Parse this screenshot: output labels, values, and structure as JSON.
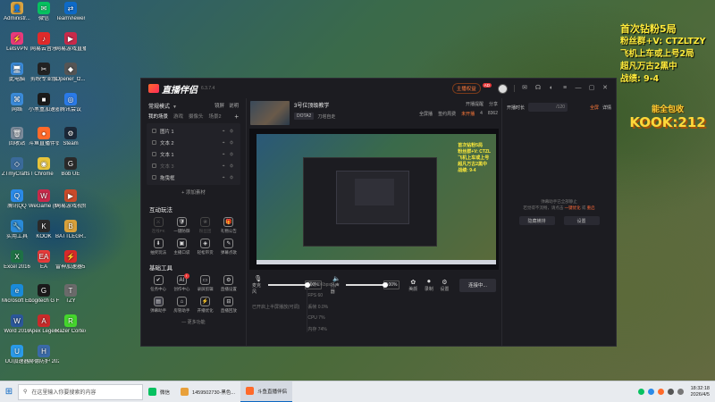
{
  "desktop_icons": [
    {
      "label": "Administr...",
      "color": "#d9a441",
      "glyph": "👤"
    },
    {
      "label": "微信",
      "color": "#07c160",
      "glyph": "✉"
    },
    {
      "label": "TeamViewer",
      "color": "#0e6ac7",
      "glyph": "⇄"
    },
    {
      "label": "LetsVPN",
      "color": "#e83a7a",
      "glyph": "⚡"
    },
    {
      "label": "网易云音乐",
      "color": "#e02a2a",
      "glyph": "♪"
    },
    {
      "label": "网易游戏直播间",
      "color": "#c82a4a",
      "glyph": "▶"
    },
    {
      "label": "此电脑",
      "color": "#3a8ad8",
      "glyph": "🖥"
    },
    {
      "label": "剪映专业版",
      "color": "#222222",
      "glyph": "✂"
    },
    {
      "label": "Opener_tz...",
      "color": "#555555",
      "glyph": "◆"
    },
    {
      "label": "网络",
      "color": "#3a8ad8",
      "glyph": "⌘"
    },
    {
      "label": "小黑盒加速器",
      "color": "#1a1a1a",
      "glyph": "■"
    },
    {
      "label": "腾讯会议",
      "color": "#2a7ae8",
      "glyph": "◎"
    },
    {
      "label": "回收站",
      "color": "#7a8a9a",
      "glyph": "🗑"
    },
    {
      "label": "斗鱼直播伴侣",
      "color": "#ff6a2a",
      "glyph": "●"
    },
    {
      "label": "Steam",
      "color": "#1b2838",
      "glyph": "⚙"
    },
    {
      "label": "ZTmyCrafts Launcher",
      "color": "#3a6a9a",
      "glyph": "◇"
    },
    {
      "label": "Chrome",
      "color": "#e8c43a",
      "glyph": "◉"
    },
    {
      "label": "Bob UE",
      "color": "#2a2a2a",
      "glyph": "G"
    },
    {
      "label": "腾讯QQ",
      "color": "#2a8ae8",
      "glyph": "Q"
    },
    {
      "label": "WeGame (Marginal)",
      "color": "#c82a4a",
      "glyph": "W"
    },
    {
      "label": "网易游戏视频直播",
      "color": "#c84a2a",
      "glyph": "▶"
    },
    {
      "label": "实用工具",
      "color": "#2a8ad8",
      "glyph": "🔧"
    },
    {
      "label": "KOOK",
      "color": "#2a2a2a",
      "glyph": "K"
    },
    {
      "label": "BATTLEGR...",
      "color": "#d8a03a",
      "glyph": "B"
    },
    {
      "label": "Excel 2016",
      "color": "#1e7145",
      "glyph": "X"
    },
    {
      "label": "EA",
      "color": "#e83a3a",
      "glyph": "EA"
    },
    {
      "label": "雷神加速器5.0",
      "color": "#d82a2a",
      "glyph": "⚡"
    },
    {
      "label": "Microsoft Edge",
      "color": "#1a8ad8",
      "glyph": "e"
    },
    {
      "label": "Logitech G HUB",
      "color": "#1a1a1a",
      "glyph": "G"
    },
    {
      "label": "TZY",
      "color": "#6a6a6a",
      "glyph": "T"
    },
    {
      "label": "Word 2016",
      "color": "#2b579a",
      "glyph": "W"
    },
    {
      "label": "Apex Legends",
      "color": "#c82a2a",
      "glyph": "A"
    },
    {
      "label": "Razer Cortex",
      "color": "#44d62c",
      "glyph": "R"
    },
    {
      "label": "UU加速器",
      "color": "#2a9ae8",
      "glyph": "U"
    },
    {
      "label": "赫德防护 20260...",
      "color": "#3a6aa8",
      "glyph": "H"
    }
  ],
  "overlay": {
    "line1": "首次钻粉5局",
    "line2": "粉丝群+V: CTZLTZY",
    "line3": "飞机上车或上号2局",
    "line4": "超凡万古2黑中",
    "line5": "战绩: 9-4"
  },
  "kook": {
    "top": "能全包收",
    "main": "KOOK:212"
  },
  "app": {
    "name": "直播伴侣",
    "version": "6.3.7.4",
    "host_label": "主播权益",
    "ad_label": "AD",
    "mode": "常规模式",
    "mode_links": [
      "镜屏",
      "说明"
    ],
    "scene_label": "我的场景",
    "scene_tabs": [
      "游戏",
      "摄像头",
      "场景2"
    ],
    "sources": [
      {
        "label": "图片 1",
        "dim": false
      },
      {
        "label": "文本 2",
        "dim": false
      },
      {
        "label": "文本 1",
        "dim": false
      },
      {
        "label": "文本 3",
        "dim": true
      },
      {
        "label": "拖曳框",
        "dim": false
      }
    ],
    "add_source": "+ 添加素材",
    "interactive_title": "互动玩法",
    "interactive_tools": [
      {
        "label": "连线PK",
        "dim": true,
        "icon": "⚔"
      },
      {
        "label": "一键防御",
        "dim": false,
        "icon": "🛡"
      },
      {
        "label": "粉丝团",
        "dim": true,
        "icon": "❀"
      },
      {
        "label": "礼物公告",
        "dim": false,
        "icon": "🎁"
      },
      {
        "label": "抽奖玩法",
        "dim": false,
        "icon": "⬇"
      },
      {
        "label": "主播口袋",
        "dim": false,
        "icon": "▣"
      },
      {
        "label": "轻松带货",
        "dim": false,
        "icon": "◈"
      },
      {
        "label": "弹幕点歌",
        "dim": false,
        "icon": "✎"
      }
    ],
    "basic_title": "基础工具",
    "basic_tools": [
      {
        "label": "任务中心",
        "icon": "✔",
        "badge": false,
        "sel": false
      },
      {
        "label": "创作中心",
        "icon": "AI",
        "badge": true,
        "sel": false
      },
      {
        "label": "录屏剪辑",
        "icon": "▭",
        "badge": false,
        "sel": false
      },
      {
        "label": "直播设置",
        "icon": "⚙",
        "badge": false,
        "sel": false
      },
      {
        "label": "弹幕助手",
        "icon": "▤",
        "badge": false,
        "sel": true
      },
      {
        "label": "房管助手",
        "icon": "⌂",
        "badge": false,
        "sel": false
      },
      {
        "label": "开播优化",
        "icon": "⚡",
        "badge": false,
        "sel": false
      },
      {
        "label": "直播回放",
        "icon": "⊟",
        "badge": false,
        "sel": false
      }
    ],
    "more_fn": "— 更多功能",
    "stream_title": "3号位顶级教学",
    "game_tag": "DOTA2",
    "category": "刀塔自走",
    "info_right": {
      "notice": "开播提醒",
      "share": "分享",
      "fullscreen": "全屏播",
      "weekly": "签约周费",
      "status": "未开播",
      "likes": "4",
      "viewers": "8362"
    },
    "audio": {
      "mic_label": "麦克风",
      "mic_pct": "100%",
      "mic_level": 1.0,
      "spk_label": "扬声器",
      "spk_pct": "100%",
      "spk_level": 1.0,
      "beauty": "美颜",
      "record": "录制",
      "settings": "设置",
      "connect": "连接中..."
    },
    "status_bar": {
      "left": "已开启上半屏播放(可调)",
      "items": [
        "网速 0Kbps",
        "FPS 60",
        "丢帧 0.0%",
        "CPU 7%",
        "内存 74%"
      ]
    },
    "chat": {
      "tab": "开播时长",
      "input_val": "/120",
      "filter": "全屏",
      "rule": "详情",
      "empty_line1": "弹幕助手已全部静止",
      "empty_line2": "若觉得不流畅，请点击",
      "empty_link": "一键优化",
      "empty_line3": "或",
      "empty_link2": "重启",
      "btn1": "隐藏横排",
      "btn2": "设置"
    }
  },
  "taskbar": {
    "search_placeholder": "在这里输入你要搜索的内容",
    "tasks": [
      {
        "label": "微信",
        "color": "#07c160",
        "active": false
      },
      {
        "label": "1459502730-黑色...",
        "color": "#e8a03a",
        "active": false
      },
      {
        "label": "斗鱼直播伴侣",
        "color": "#ff6a2a",
        "active": true
      }
    ],
    "time": "18:32:18",
    "date": "2026/4/5"
  },
  "preview_text": [
    "首次钻粉5局",
    "粉丝群+V: CTZL",
    "飞机上车或上号",
    "超凡万古2黑中",
    "战绩: 9-4"
  ]
}
